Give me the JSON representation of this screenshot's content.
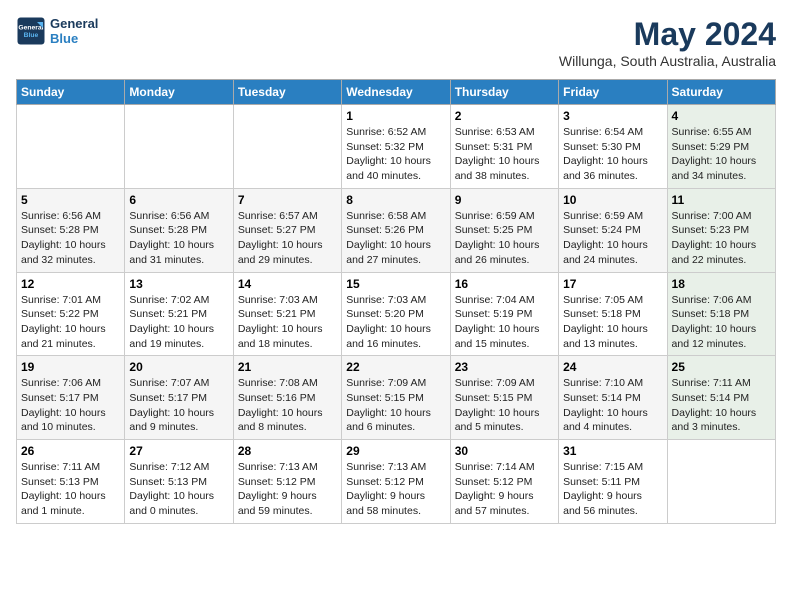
{
  "logo": {
    "line1": "General",
    "line2": "Blue"
  },
  "title": "May 2024",
  "location": "Willunga, South Australia, Australia",
  "days_of_week": [
    "Sunday",
    "Monday",
    "Tuesday",
    "Wednesday",
    "Thursday",
    "Friday",
    "Saturday"
  ],
  "weeks": [
    [
      {
        "day": "",
        "info": ""
      },
      {
        "day": "",
        "info": ""
      },
      {
        "day": "",
        "info": ""
      },
      {
        "day": "1",
        "info": "Sunrise: 6:52 AM\nSunset: 5:32 PM\nDaylight: 10 hours\nand 40 minutes."
      },
      {
        "day": "2",
        "info": "Sunrise: 6:53 AM\nSunset: 5:31 PM\nDaylight: 10 hours\nand 38 minutes."
      },
      {
        "day": "3",
        "info": "Sunrise: 6:54 AM\nSunset: 5:30 PM\nDaylight: 10 hours\nand 36 minutes."
      },
      {
        "day": "4",
        "info": "Sunrise: 6:55 AM\nSunset: 5:29 PM\nDaylight: 10 hours\nand 34 minutes."
      }
    ],
    [
      {
        "day": "5",
        "info": "Sunrise: 6:56 AM\nSunset: 5:28 PM\nDaylight: 10 hours\nand 32 minutes."
      },
      {
        "day": "6",
        "info": "Sunrise: 6:56 AM\nSunset: 5:28 PM\nDaylight: 10 hours\nand 31 minutes."
      },
      {
        "day": "7",
        "info": "Sunrise: 6:57 AM\nSunset: 5:27 PM\nDaylight: 10 hours\nand 29 minutes."
      },
      {
        "day": "8",
        "info": "Sunrise: 6:58 AM\nSunset: 5:26 PM\nDaylight: 10 hours\nand 27 minutes."
      },
      {
        "day": "9",
        "info": "Sunrise: 6:59 AM\nSunset: 5:25 PM\nDaylight: 10 hours\nand 26 minutes."
      },
      {
        "day": "10",
        "info": "Sunrise: 6:59 AM\nSunset: 5:24 PM\nDaylight: 10 hours\nand 24 minutes."
      },
      {
        "day": "11",
        "info": "Sunrise: 7:00 AM\nSunset: 5:23 PM\nDaylight: 10 hours\nand 22 minutes."
      }
    ],
    [
      {
        "day": "12",
        "info": "Sunrise: 7:01 AM\nSunset: 5:22 PM\nDaylight: 10 hours\nand 21 minutes."
      },
      {
        "day": "13",
        "info": "Sunrise: 7:02 AM\nSunset: 5:21 PM\nDaylight: 10 hours\nand 19 minutes."
      },
      {
        "day": "14",
        "info": "Sunrise: 7:03 AM\nSunset: 5:21 PM\nDaylight: 10 hours\nand 18 minutes."
      },
      {
        "day": "15",
        "info": "Sunrise: 7:03 AM\nSunset: 5:20 PM\nDaylight: 10 hours\nand 16 minutes."
      },
      {
        "day": "16",
        "info": "Sunrise: 7:04 AM\nSunset: 5:19 PM\nDaylight: 10 hours\nand 15 minutes."
      },
      {
        "day": "17",
        "info": "Sunrise: 7:05 AM\nSunset: 5:18 PM\nDaylight: 10 hours\nand 13 minutes."
      },
      {
        "day": "18",
        "info": "Sunrise: 7:06 AM\nSunset: 5:18 PM\nDaylight: 10 hours\nand 12 minutes."
      }
    ],
    [
      {
        "day": "19",
        "info": "Sunrise: 7:06 AM\nSunset: 5:17 PM\nDaylight: 10 hours\nand 10 minutes."
      },
      {
        "day": "20",
        "info": "Sunrise: 7:07 AM\nSunset: 5:17 PM\nDaylight: 10 hours\nand 9 minutes."
      },
      {
        "day": "21",
        "info": "Sunrise: 7:08 AM\nSunset: 5:16 PM\nDaylight: 10 hours\nand 8 minutes."
      },
      {
        "day": "22",
        "info": "Sunrise: 7:09 AM\nSunset: 5:15 PM\nDaylight: 10 hours\nand 6 minutes."
      },
      {
        "day": "23",
        "info": "Sunrise: 7:09 AM\nSunset: 5:15 PM\nDaylight: 10 hours\nand 5 minutes."
      },
      {
        "day": "24",
        "info": "Sunrise: 7:10 AM\nSunset: 5:14 PM\nDaylight: 10 hours\nand 4 minutes."
      },
      {
        "day": "25",
        "info": "Sunrise: 7:11 AM\nSunset: 5:14 PM\nDaylight: 10 hours\nand 3 minutes."
      }
    ],
    [
      {
        "day": "26",
        "info": "Sunrise: 7:11 AM\nSunset: 5:13 PM\nDaylight: 10 hours\nand 1 minute."
      },
      {
        "day": "27",
        "info": "Sunrise: 7:12 AM\nSunset: 5:13 PM\nDaylight: 10 hours\nand 0 minutes."
      },
      {
        "day": "28",
        "info": "Sunrise: 7:13 AM\nSunset: 5:12 PM\nDaylight: 9 hours\nand 59 minutes."
      },
      {
        "day": "29",
        "info": "Sunrise: 7:13 AM\nSunset: 5:12 PM\nDaylight: 9 hours\nand 58 minutes."
      },
      {
        "day": "30",
        "info": "Sunrise: 7:14 AM\nSunset: 5:12 PM\nDaylight: 9 hours\nand 57 minutes."
      },
      {
        "day": "31",
        "info": "Sunrise: 7:15 AM\nSunset: 5:11 PM\nDaylight: 9 hours\nand 56 minutes."
      },
      {
        "day": "",
        "info": ""
      }
    ]
  ]
}
